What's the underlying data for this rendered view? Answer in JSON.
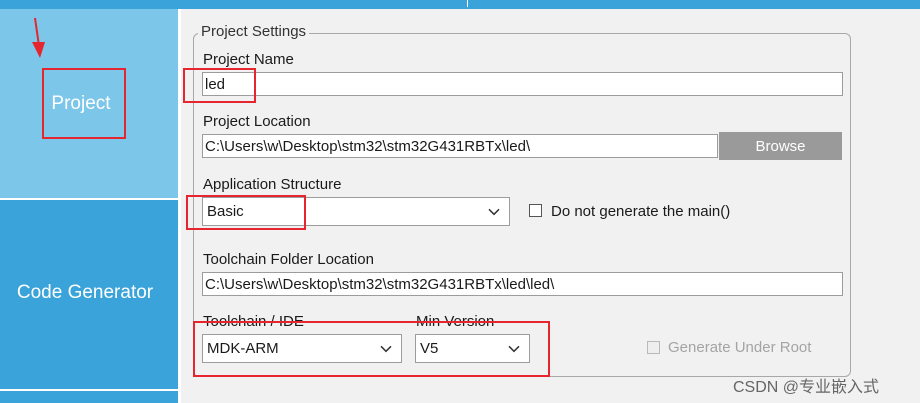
{
  "sidebar": {
    "items": [
      {
        "label": "Project"
      },
      {
        "label": "Code Generator"
      }
    ]
  },
  "project_settings": {
    "legend": "Project Settings",
    "project_name": {
      "label": "Project Name",
      "value": "led"
    },
    "project_location": {
      "label": "Project Location",
      "value": "C:\\Users\\w\\Desktop\\stm32\\stm32G431RBTx\\led\\",
      "browse_label": "Browse"
    },
    "application_structure": {
      "label": "Application Structure",
      "selected": "Basic",
      "checkbox_label": "Do not generate the main()"
    },
    "toolchain_folder": {
      "label": "Toolchain Folder Location",
      "value": "C:\\Users\\w\\Desktop\\stm32\\stm32G431RBTx\\led\\led\\"
    },
    "toolchain_ide": {
      "label": "Toolchain / IDE",
      "selected": "MDK-ARM"
    },
    "min_version": {
      "label": "Min Version",
      "selected": "V5"
    },
    "generate_under_root": {
      "label": "Generate Under Root"
    }
  },
  "watermark": "CSDN @专业嵌入式",
  "colors": {
    "sidebar_active": "#7cc6ea",
    "sidebar_inactive": "#3aa3d9",
    "annotation_red": "#e5262e",
    "panel_bg": "#f1f1f1"
  }
}
